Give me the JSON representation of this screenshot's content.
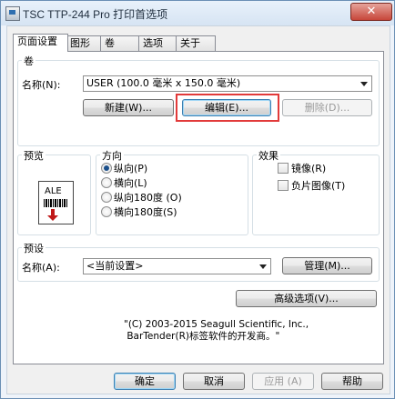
{
  "window": {
    "title": "TSC TTP-244 Pro 打印首选项",
    "close_glyph": "✕"
  },
  "tabs": [
    {
      "label": "页面设置",
      "active": true
    },
    {
      "label": "图形",
      "active": false
    },
    {
      "label": "卷",
      "active": false
    },
    {
      "label": "选项",
      "active": false
    },
    {
      "label": "关于",
      "active": false
    }
  ],
  "roll": {
    "group_label": "卷",
    "name_label": "名称(N):",
    "name_value": "USER (100.0 毫米 x 150.0 毫米)",
    "new_button": "新建(W)...",
    "edit_button": "编辑(E)...",
    "delete_button": "删除(D)..."
  },
  "preview": {
    "group_label": "预览",
    "sample_text": "ALE"
  },
  "orientation": {
    "group_label": "方向",
    "options": [
      {
        "label": "纵向(P)",
        "selected": true
      },
      {
        "label": "横向(L)",
        "selected": false
      },
      {
        "label": "纵向180度 (O)",
        "selected": false
      },
      {
        "label": "横向180度(S)",
        "selected": false
      }
    ]
  },
  "effects": {
    "group_label": "效果",
    "options": [
      {
        "label": "镜像(R)",
        "checked": false
      },
      {
        "label": "负片图像(T)",
        "checked": false
      }
    ]
  },
  "presets": {
    "group_label": "预设",
    "name_label": "名称(A):",
    "name_value": "<当前设置>",
    "manage_button": "管理(M)..."
  },
  "advanced_button": "高级选项(V)...",
  "copyright": "\"(C) 2003-2015 Seagull Scientific, Inc.,\n BarTender(R)标签软件的开发商。\"",
  "footer": {
    "ok": "确定",
    "cancel": "取消",
    "apply": "应用 (A)",
    "help": "帮助"
  },
  "colors": {
    "highlight": "#e23a3a",
    "accent": "#1b4f8a"
  }
}
